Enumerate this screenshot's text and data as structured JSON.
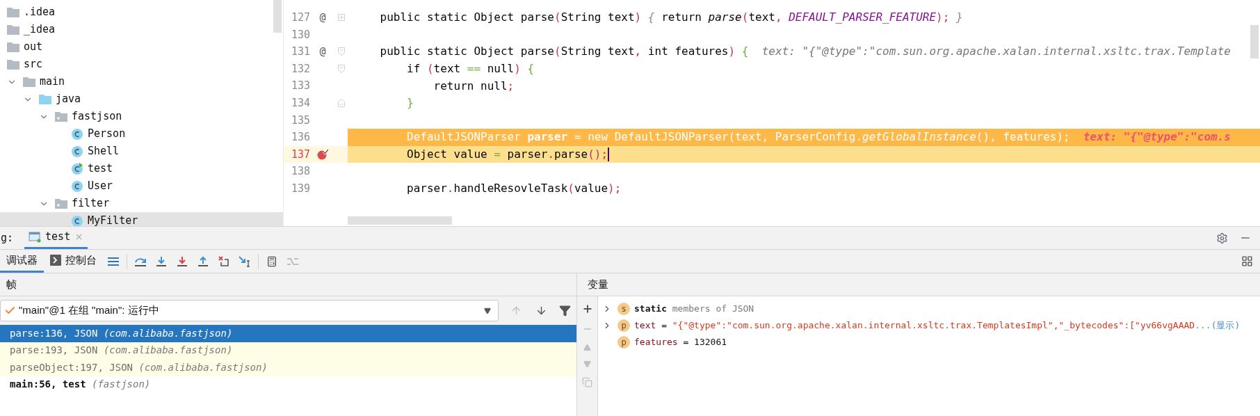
{
  "project_tree": {
    "items": [
      {
        "label": ".idea",
        "kind": "folder"
      },
      {
        "label": "_idea",
        "kind": "folder"
      },
      {
        "label": "out",
        "kind": "folder"
      },
      {
        "label": "src",
        "kind": "folder",
        "children": [
          {
            "label": "main",
            "kind": "folder",
            "expanded": true,
            "children": [
              {
                "label": "java",
                "kind": "source-folder",
                "expanded": true,
                "children": [
                  {
                    "label": "fastjson",
                    "kind": "package",
                    "expanded": true,
                    "children": [
                      {
                        "label": "Person",
                        "kind": "class",
                        "selected": false
                      },
                      {
                        "label": "Shell",
                        "kind": "class",
                        "selected": false
                      },
                      {
                        "label": "test",
                        "kind": "runnable-class",
                        "selected": false
                      },
                      {
                        "label": "User",
                        "kind": "class",
                        "selected": false
                      }
                    ]
                  },
                  {
                    "label": "filter",
                    "kind": "package",
                    "expanded": true,
                    "children": [
                      {
                        "label": "MyFilter",
                        "kind": "class",
                        "selected": true
                      }
                    ]
                  }
                ]
              }
            ]
          }
        ]
      }
    ]
  },
  "editor": {
    "lines": [
      {
        "number": "127",
        "gutter_mark": "@",
        "fold_marker": {
          "kind": "collapsed"
        },
        "kind": "normal",
        "tokens": [
          {
            "text": "    public static Object parse",
            "kind": "plain"
          },
          {
            "text": "(",
            "kind": "paren"
          },
          {
            "text": "String text",
            "kind": "plain"
          },
          {
            "text": ")",
            "kind": "paren"
          },
          {
            "text": " {",
            "kind": "fold"
          },
          {
            "text": " return ",
            "kind": "plain"
          },
          {
            "text": "parse",
            "kind": "italic"
          },
          {
            "text": "(",
            "kind": "paren"
          },
          {
            "text": "text",
            "kind": "plain"
          },
          {
            "text": ", ",
            "kind": "semi"
          },
          {
            "text": "DEFAULT_PARSER_FEATURE",
            "kind": "const"
          },
          {
            "text": ")",
            "kind": "paren"
          },
          {
            "text": ";",
            "kind": "semi"
          },
          {
            "text": " }",
            "kind": "fold"
          }
        ]
      },
      {
        "number": "130",
        "kind": "normal"
      },
      {
        "number": "131",
        "gutter_mark": "@",
        "fold_marker": {
          "kind": "open"
        },
        "kind": "normal",
        "tokens": [
          {
            "text": "    public static Object parse",
            "kind": "plain"
          },
          {
            "text": "(",
            "kind": "paren"
          },
          {
            "text": "String text",
            "kind": "plain"
          },
          {
            "text": ", ",
            "kind": "semi"
          },
          {
            "text": "int features",
            "kind": "plain"
          },
          {
            "text": ")",
            "kind": "paren"
          },
          {
            "text": " {",
            "kind": "brace"
          },
          {
            "text": "  text: \"{\"@type\":\"com.sun.org.apache.xalan.internal.xsltc.trax.Template",
            "kind": "hint"
          }
        ]
      },
      {
        "number": "132",
        "fold_marker": {
          "kind": "open"
        },
        "kind": "normal",
        "tokens": [
          {
            "text": "        if ",
            "kind": "plain"
          },
          {
            "text": "(",
            "kind": "paren"
          },
          {
            "text": "text ",
            "kind": "plain"
          },
          {
            "text": "==",
            "kind": "op"
          },
          {
            "text": " null",
            "kind": "plain"
          },
          {
            "text": ")",
            "kind": "paren"
          },
          {
            "text": " {",
            "kind": "brace"
          }
        ]
      },
      {
        "number": "133",
        "kind": "normal",
        "tokens": [
          {
            "text": "            return null",
            "kind": "plain"
          },
          {
            "text": ";",
            "kind": "semi"
          }
        ]
      },
      {
        "number": "134",
        "fold_marker": {
          "kind": "close"
        },
        "kind": "normal",
        "tokens": [
          {
            "text": "        }",
            "kind": "brace"
          }
        ]
      },
      {
        "number": "135",
        "kind": "normal"
      },
      {
        "number": "136",
        "kind": "execution",
        "tokens": [
          {
            "text": "        DefaultJSONParser ",
            "kind": "plain"
          },
          {
            "text": "parser",
            "kind": "bold"
          },
          {
            "text": " = new DefaultJSONParser(text, ParserConfig.",
            "kind": "plain"
          },
          {
            "text": "getGlobalInstance",
            "kind": "italic"
          },
          {
            "text": "(), features);",
            "kind": "plain"
          },
          {
            "text": "  text: \"{\"@type\":\"com.s",
            "kind": "hint-alert"
          }
        ]
      },
      {
        "number": "137",
        "breakpoint": true,
        "caret": true,
        "kind": "current",
        "tokens": [
          {
            "text": "        Object value ",
            "kind": "plain"
          },
          {
            "text": "=",
            "kind": "op"
          },
          {
            "text": " parser",
            "kind": "plain"
          },
          {
            "text": ".",
            "kind": "semi"
          },
          {
            "text": "parse",
            "kind": "plain"
          },
          {
            "text": "()",
            "kind": "paren"
          },
          {
            "text": ";",
            "kind": "semi"
          }
        ]
      },
      {
        "number": "138",
        "kind": "normal"
      },
      {
        "number": "139",
        "kind": "normal",
        "tokens": [
          {
            "text": "        parser",
            "kind": "plain"
          },
          {
            "text": ".",
            "kind": "semi"
          },
          {
            "text": "handleResovleTask",
            "kind": "plain"
          },
          {
            "text": "(",
            "kind": "paren"
          },
          {
            "text": "value",
            "kind": "plain"
          },
          {
            "text": ")",
            "kind": "paren"
          },
          {
            "text": ";",
            "kind": "semi"
          }
        ]
      }
    ]
  },
  "debug": {
    "label": "g:",
    "tabs": [
      {
        "label": "test",
        "selected": true
      }
    ],
    "subtabs": [
      {
        "label": "调试器",
        "kind": "debugger",
        "selected": true
      },
      {
        "label": "控制台",
        "kind": "console",
        "selected": false
      }
    ],
    "frames": {
      "header": "帧",
      "thread": "\"main\"@1 在组 \"main\": 运行中",
      "items": [
        {
          "method": "parse:136, JSON",
          "package": "(com.alibaba.fastjson)",
          "kind": "library",
          "selected": true
        },
        {
          "method": "parse:193, JSON",
          "package": "(com.alibaba.fastjson)",
          "kind": "library",
          "selected": false
        },
        {
          "method": "parseObject:197, JSON",
          "package": "(com.alibaba.fastjson)",
          "kind": "library",
          "selected": false
        },
        {
          "method": "main:56, test",
          "package": "(fastjson)",
          "kind": "user",
          "selected": false
        }
      ]
    },
    "variables": {
      "header": "变量",
      "items": [
        {
          "badge": "s",
          "kind": "static",
          "expandable": true,
          "name": "static",
          "value": "members of JSON"
        },
        {
          "badge": "p",
          "kind": "string",
          "expandable": true,
          "name": "text",
          "operator": "=",
          "value": "\"{\"@type\":\"com.sun.org.apache.xalan.internal.xsltc.trax.TemplatesImpl\",\"_bytecodes\":[\"yv66vgAAAD",
          "link": "...(显示)"
        },
        {
          "badge": "p",
          "kind": "number",
          "expandable": false,
          "name": "features",
          "operator": "=",
          "value": "132061"
        }
      ]
    }
  }
}
